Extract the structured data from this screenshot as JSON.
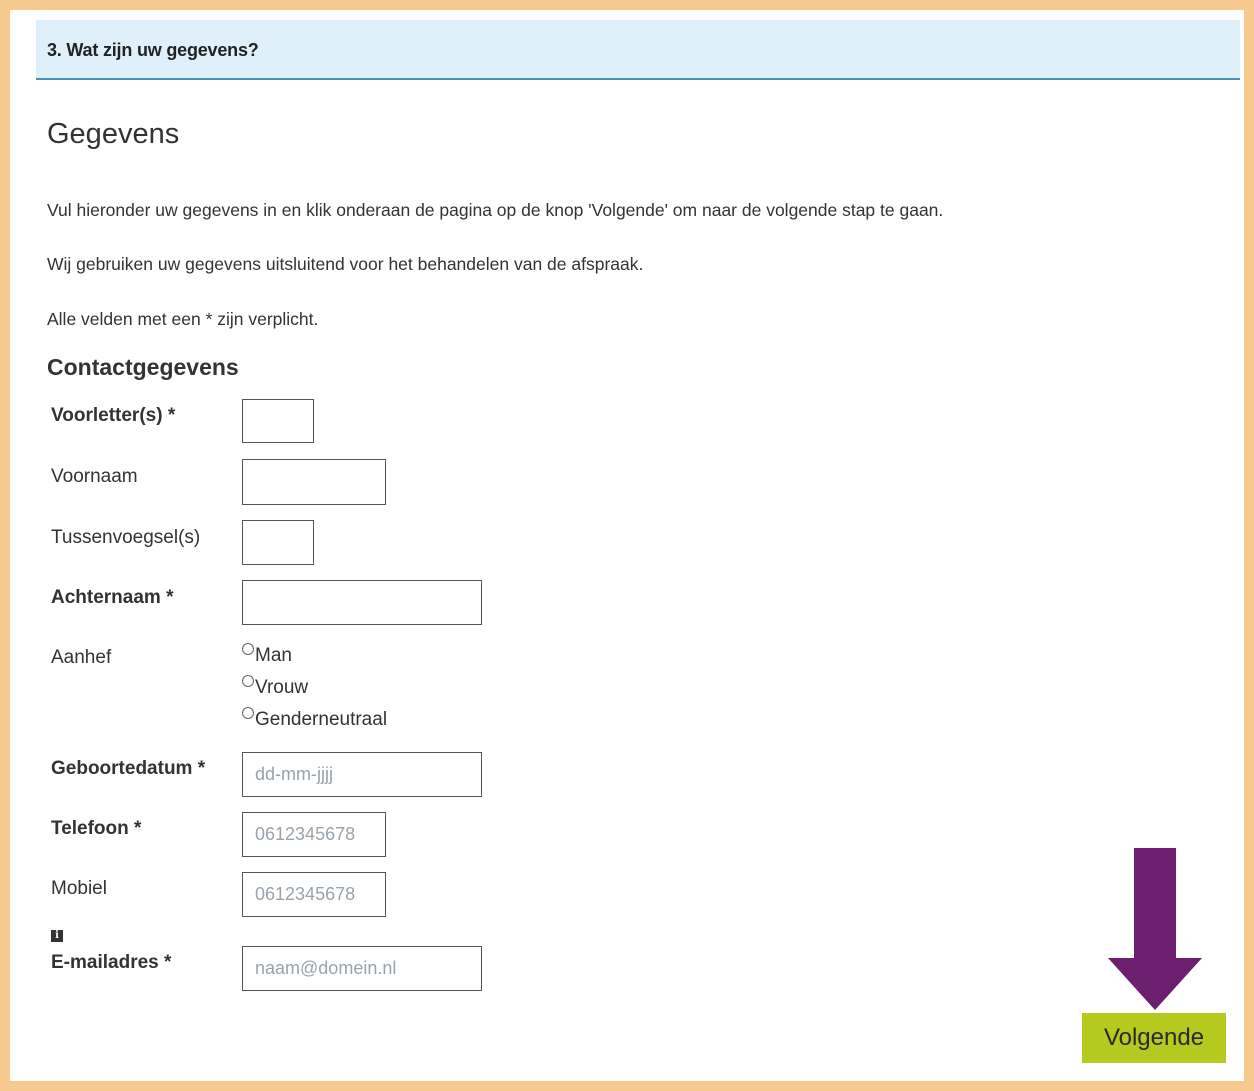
{
  "step_header": "3. Wat zijn uw gegevens?",
  "title": "Gegevens",
  "intro": [
    "Vul hieronder uw gegevens in en klik onderaan de pagina op de knop 'Volgende' om naar de volgende stap te gaan.",
    "Wij gebruiken uw gegevens uitsluitend voor het behandelen van de afspraak.",
    "Alle velden met een * zijn verplicht."
  ],
  "section_title": "Contactgegevens",
  "fields": {
    "initials": {
      "label": "Voorletter(s) *",
      "value": "",
      "placeholder": ""
    },
    "firstname": {
      "label": "Voornaam",
      "value": "",
      "placeholder": ""
    },
    "infix": {
      "label": "Tussenvoegsel(s)",
      "value": "",
      "placeholder": ""
    },
    "lastname": {
      "label": "Achternaam *",
      "value": "",
      "placeholder": ""
    },
    "salutation": {
      "label": "Aanhef",
      "options": [
        "Man",
        "Vrouw",
        "Genderneutraal"
      ],
      "selected": null
    },
    "birthdate": {
      "label": "Geboortedatum *",
      "value": "",
      "placeholder": "dd-mm-jjjj"
    },
    "phone": {
      "label": "Telefoon *",
      "value": "",
      "placeholder": "0612345678"
    },
    "mobile": {
      "label": "Mobiel",
      "value": "",
      "placeholder": "0612345678"
    },
    "email": {
      "label": "E-mailadres *",
      "value": "",
      "placeholder": "naam@domein.nl",
      "info_icon": "info-icon"
    }
  },
  "next_button": "Volgende",
  "colors": {
    "frame": "#f6c98e",
    "step_bar": "#dff0fb",
    "step_bar_border": "#4a90b8",
    "button": "#b5c91e",
    "arrow": "#6b1f6e"
  }
}
